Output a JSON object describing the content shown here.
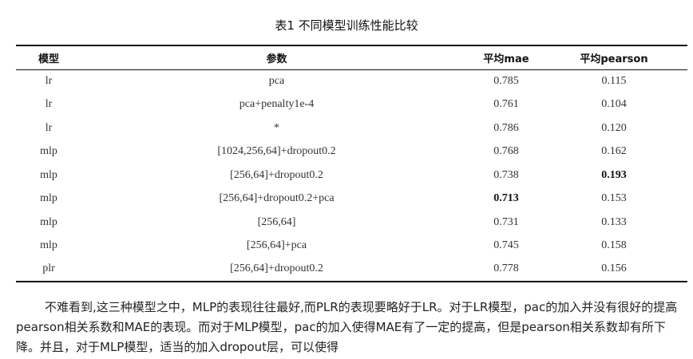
{
  "caption": "表1 不同模型训练性能比较",
  "table": {
    "headers": {
      "model": "模型",
      "params": "参数",
      "mae": "平均mae",
      "pearson": "平均pearson"
    },
    "rows": [
      {
        "model": "lr",
        "params": "pca",
        "mae": "0.785",
        "pearson": "0.115"
      },
      {
        "model": "lr",
        "params": "pca+penalty1e-4",
        "mae": "0.761",
        "pearson": "0.104"
      },
      {
        "model": "lr",
        "params": "*",
        "mae": "0.786",
        "pearson": "0.120"
      },
      {
        "model": "mlp",
        "params": "[1024,256,64]+dropout0.2",
        "mae": "0.768",
        "pearson": "0.162"
      },
      {
        "model": "mlp",
        "params": "[256,64]+dropout0.2",
        "mae": "0.738",
        "pearson": "0.193"
      },
      {
        "model": "mlp",
        "params": "[256,64]+dropout0.2+pca",
        "mae": "0.713",
        "pearson": "0.153"
      },
      {
        "model": "mlp",
        "params": "[256,64]",
        "mae": "0.731",
        "pearson": "0.133"
      },
      {
        "model": "mlp",
        "params": "[256,64]+pca",
        "mae": "0.745",
        "pearson": "0.158"
      },
      {
        "model": "plr",
        "params": "[256,64]+dropout0.2",
        "mae": "0.778",
        "pearson": "0.156"
      }
    ]
  },
  "body_text": "不难看到,这三种模型之中，MLP的表现往往最好,而PLR的表现要略好于LR。对于LR模型，pac的加入并没有很好的提高pearson相关系数和MAE的表现。而对于MLP模型，pac的加入使得MAE有了一定的提高，但是pearson相关系数却有所下降。并且，对于MLP模型，适当的加入dropout层，可以使得"
}
